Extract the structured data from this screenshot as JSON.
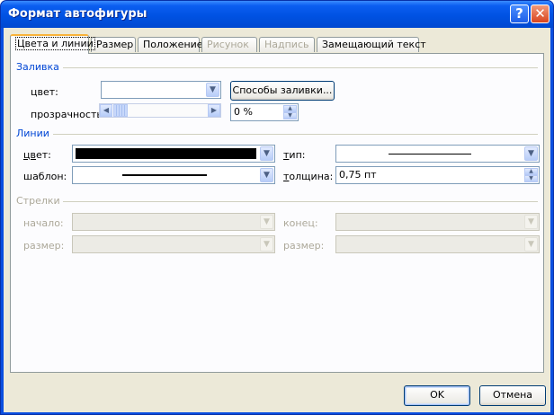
{
  "window": {
    "title": "Формат автофигуры"
  },
  "tabs": [
    {
      "label": "Цвета и линии",
      "state": "active"
    },
    {
      "label": "Размер",
      "state": "normal"
    },
    {
      "label": "Положение",
      "state": "normal"
    },
    {
      "label": "Рисунок",
      "state": "disabled"
    },
    {
      "label": "Надпись",
      "state": "disabled"
    },
    {
      "label": "Замещающий текст",
      "state": "normal"
    }
  ],
  "fill": {
    "section": "Заливка",
    "color_label": "цвет:",
    "color_value": "",
    "fill_methods_button": "Способы заливки...",
    "transparency_label": "прозрачность:",
    "transparency_value": "0 %"
  },
  "lines": {
    "section": "Линии",
    "color_label_u": "цв",
    "color_label_rest": "ет:",
    "color_value": "#000000",
    "pattern_label": "шаблон:",
    "type_label_u": "т",
    "type_label_rest": "ип:",
    "weight_label_u": "т",
    "weight_label_rest": "олщина:",
    "weight_value": "0,75 пт"
  },
  "arrows": {
    "section": "Стрелки",
    "begin_style_label": "начало:",
    "begin_size_label": "размер:",
    "end_style_label": "конец:",
    "end_size_label": "размер:"
  },
  "footer": {
    "ok": "OK",
    "cancel": "Отмена"
  }
}
